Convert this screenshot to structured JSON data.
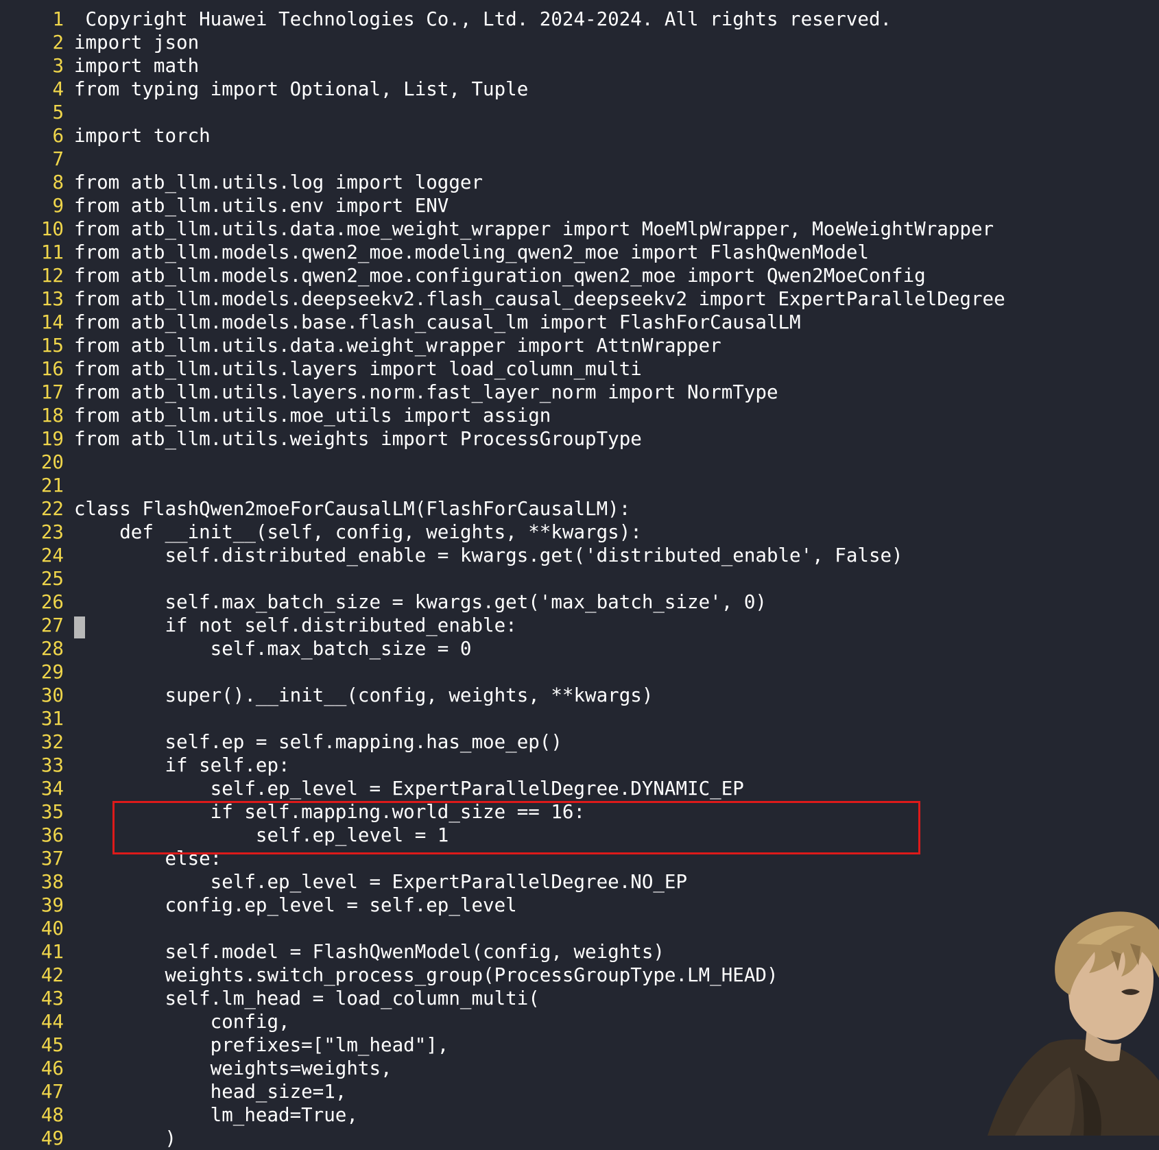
{
  "editor": {
    "lines": [
      {
        "num": "1",
        "text": " Copyright Huawei Technologies Co., Ltd. 2024-2024. All rights reserved."
      },
      {
        "num": "2",
        "text": "import json"
      },
      {
        "num": "3",
        "text": "import math"
      },
      {
        "num": "4",
        "text": "from typing import Optional, List, Tuple"
      },
      {
        "num": "5",
        "text": ""
      },
      {
        "num": "6",
        "text": "import torch"
      },
      {
        "num": "7",
        "text": ""
      },
      {
        "num": "8",
        "text": "from atb_llm.utils.log import logger"
      },
      {
        "num": "9",
        "text": "from atb_llm.utils.env import ENV"
      },
      {
        "num": "10",
        "text": "from atb_llm.utils.data.moe_weight_wrapper import MoeMlpWrapper, MoeWeightWrapper"
      },
      {
        "num": "11",
        "text": "from atb_llm.models.qwen2_moe.modeling_qwen2_moe import FlashQwenModel"
      },
      {
        "num": "12",
        "text": "from atb_llm.models.qwen2_moe.configuration_qwen2_moe import Qwen2MoeConfig"
      },
      {
        "num": "13",
        "text": "from atb_llm.models.deepseekv2.flash_causal_deepseekv2 import ExpertParallelDegree"
      },
      {
        "num": "14",
        "text": "from atb_llm.models.base.flash_causal_lm import FlashForCausalLM"
      },
      {
        "num": "15",
        "text": "from atb_llm.utils.data.weight_wrapper import AttnWrapper"
      },
      {
        "num": "16",
        "text": "from atb_llm.utils.layers import load_column_multi"
      },
      {
        "num": "17",
        "text": "from atb_llm.utils.layers.norm.fast_layer_norm import NormType"
      },
      {
        "num": "18",
        "text": "from atb_llm.utils.moe_utils import assign"
      },
      {
        "num": "19",
        "text": "from atb_llm.utils.weights import ProcessGroupType"
      },
      {
        "num": "20",
        "text": ""
      },
      {
        "num": "21",
        "text": ""
      },
      {
        "num": "22",
        "text": "class FlashQwen2moeForCausalLM(FlashForCausalLM):"
      },
      {
        "num": "23",
        "text": "    def __init__(self, config, weights, **kwargs):"
      },
      {
        "num": "24",
        "text": "        self.distributed_enable = kwargs.get('distributed_enable', False)"
      },
      {
        "num": "25",
        "text": ""
      },
      {
        "num": "26",
        "text": "        self.max_batch_size = kwargs.get('max_batch_size', 0)"
      },
      {
        "num": "27",
        "text": "        if not self.distributed_enable:"
      },
      {
        "num": "28",
        "text": "            self.max_batch_size = 0"
      },
      {
        "num": "29",
        "text": ""
      },
      {
        "num": "30",
        "text": "        super().__init__(config, weights, **kwargs)"
      },
      {
        "num": "31",
        "text": ""
      },
      {
        "num": "32",
        "text": "        self.ep = self.mapping.has_moe_ep()"
      },
      {
        "num": "33",
        "text": "        if self.ep:"
      },
      {
        "num": "34",
        "text": "            self.ep_level = ExpertParallelDegree.DYNAMIC_EP"
      },
      {
        "num": "35",
        "text": "            if self.mapping.world_size == 16:"
      },
      {
        "num": "36",
        "text": "                self.ep_level = 1"
      },
      {
        "num": "37",
        "text": "        else:"
      },
      {
        "num": "38",
        "text": "            self.ep_level = ExpertParallelDegree.NO_EP"
      },
      {
        "num": "39",
        "text": "        config.ep_level = self.ep_level"
      },
      {
        "num": "40",
        "text": ""
      },
      {
        "num": "41",
        "text": "        self.model = FlashQwenModel(config, weights)"
      },
      {
        "num": "42",
        "text": "        weights.switch_process_group(ProcessGroupType.LM_HEAD)"
      },
      {
        "num": "43",
        "text": "        self.lm_head = load_column_multi("
      },
      {
        "num": "44",
        "text": "            config,"
      },
      {
        "num": "45",
        "text": "            prefixes=[\"lm_head\"],"
      },
      {
        "num": "46",
        "text": "            weights=weights,"
      },
      {
        "num": "47",
        "text": "            head_size=1,"
      },
      {
        "num": "48",
        "text": "            lm_head=True,"
      },
      {
        "num": "49",
        "text": "        )"
      }
    ]
  },
  "colors": {
    "background": "#232630",
    "line_number": "#f0d64b",
    "code_text": "#ffffff",
    "highlight_border": "#dd1a1a",
    "cursor": "#b8b8b8"
  },
  "decorations": {
    "cursor_line": "27",
    "highlighted_lines": [
      "35",
      "36"
    ],
    "corner_image": "anime-character-illustration"
  }
}
